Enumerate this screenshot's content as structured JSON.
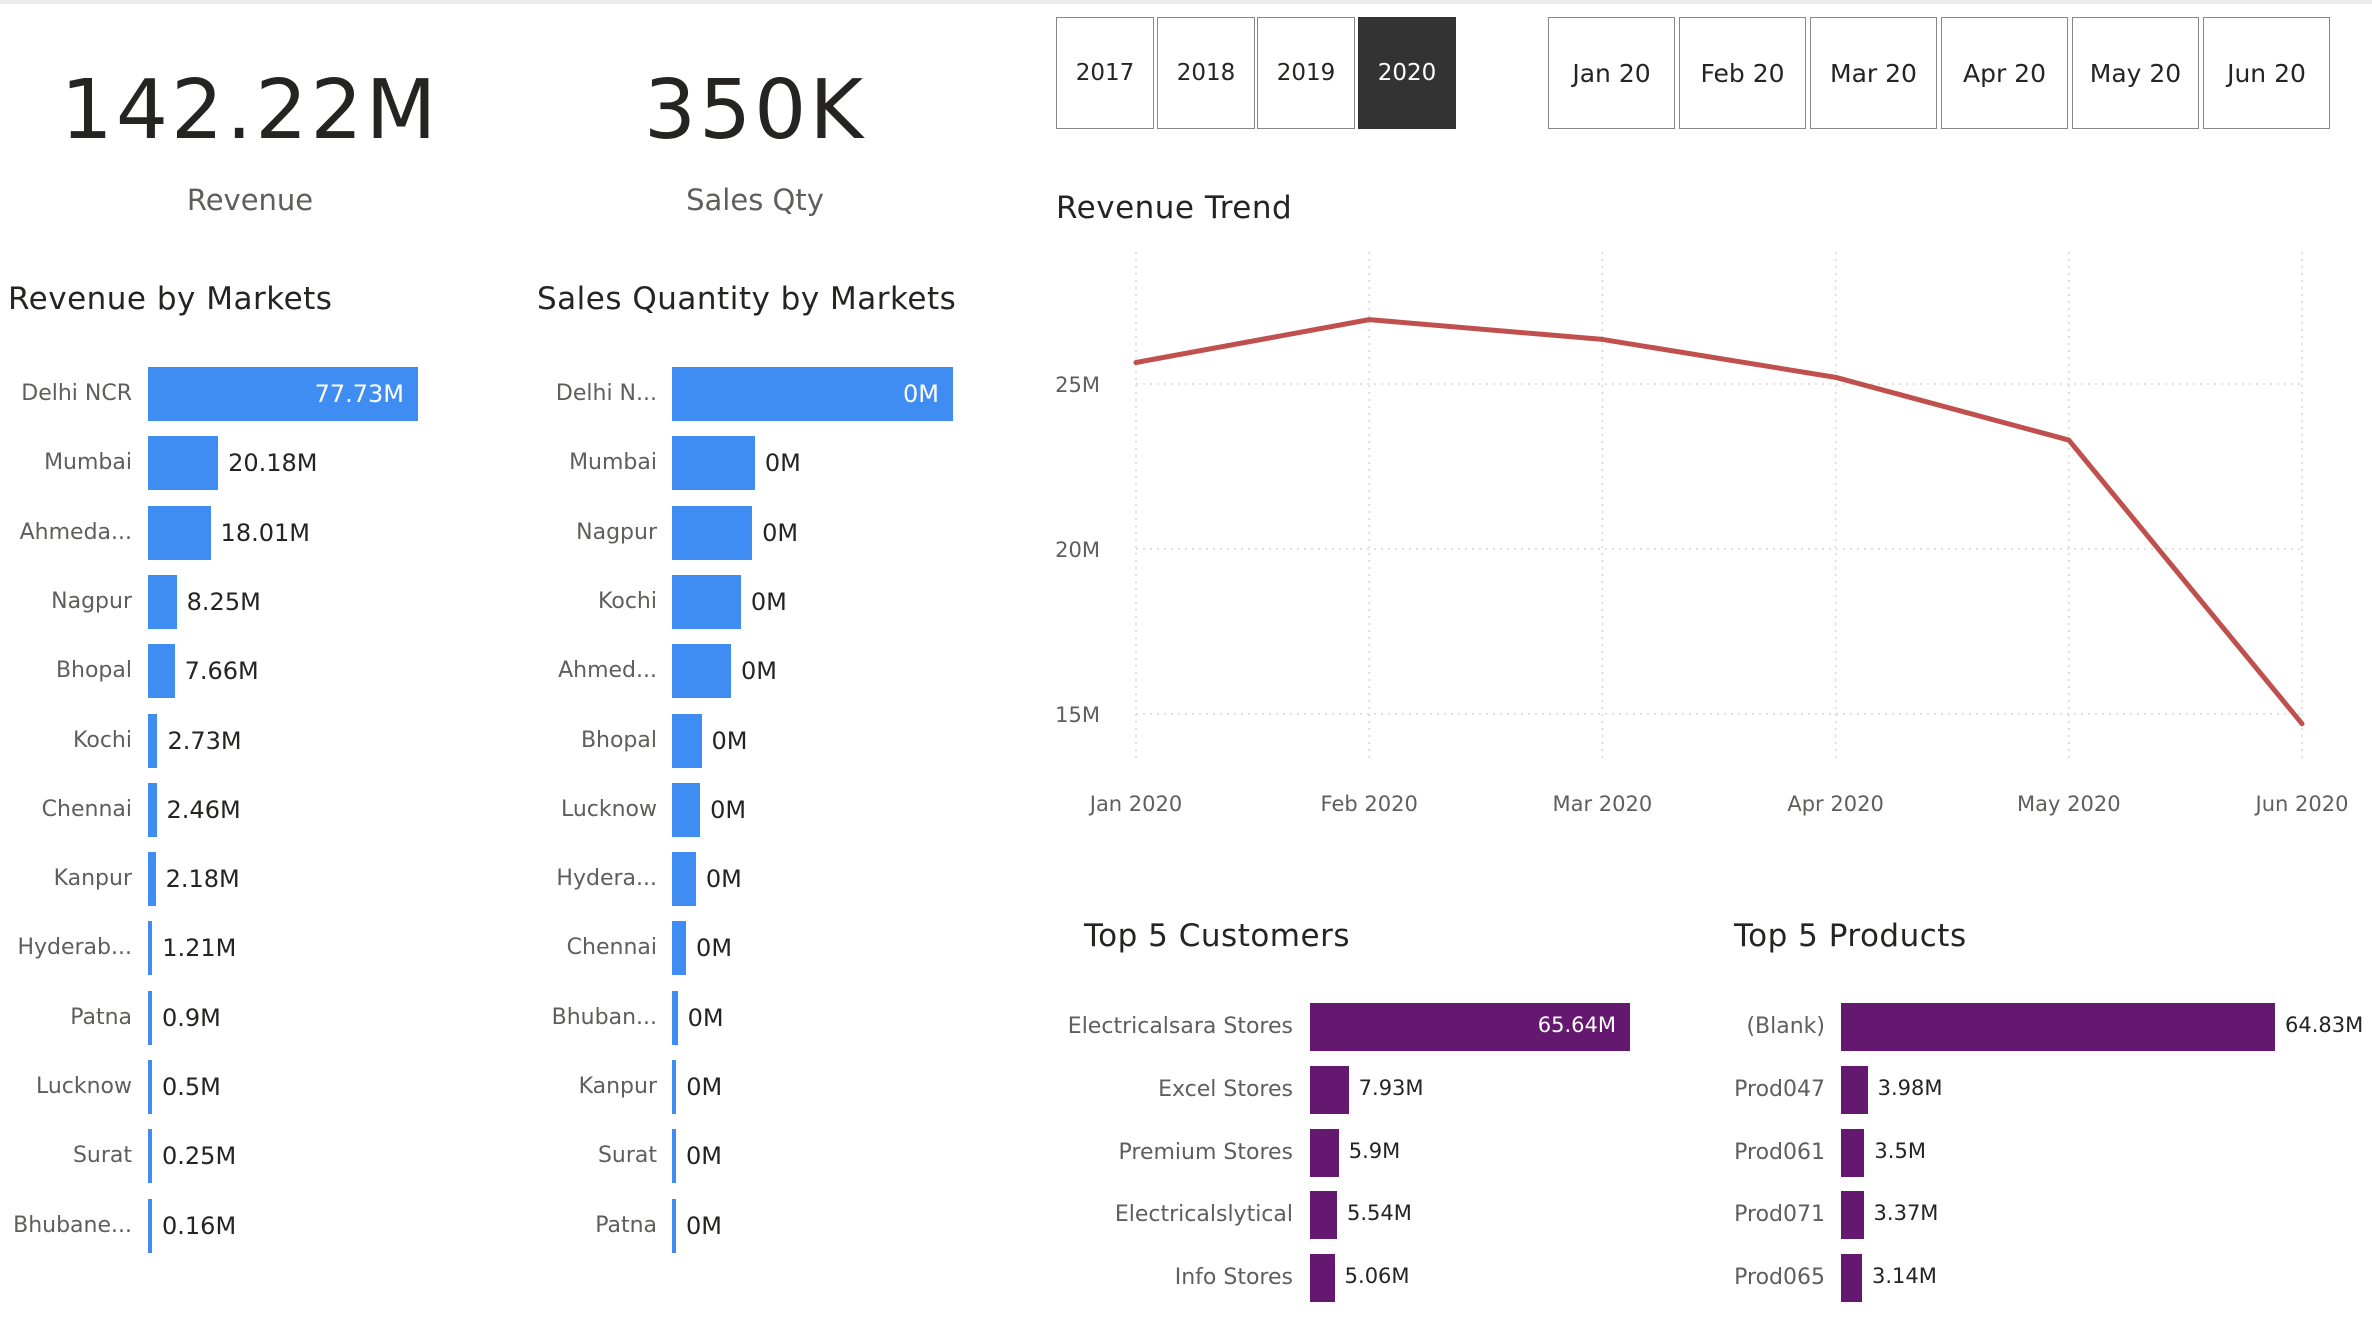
{
  "kpis": {
    "revenue": {
      "value": "142.22M",
      "label": "Revenue"
    },
    "sales_qty": {
      "value": "350K",
      "label": "Sales Qty"
    }
  },
  "year_slicer": {
    "items": [
      "2017",
      "2018",
      "2019",
      "2020"
    ],
    "selected": "2020"
  },
  "month_slicer": {
    "items": [
      "Jan 20",
      "Feb 20",
      "Mar 20",
      "Apr 20",
      "May 20",
      "Jun 20"
    ]
  },
  "colors": {
    "market_bar": "#3f8cf2",
    "top5_bar": "#651870",
    "trend_line": "#c0504d",
    "selected_slicer": "#333333"
  },
  "revenue_by_markets": {
    "title": "Revenue by Markets",
    "chart_data": {
      "type": "bar",
      "orientation": "horizontal",
      "categories": [
        "Delhi NCR",
        "Mumbai",
        "Ahmeda...",
        "Nagpur",
        "Bhopal",
        "Kochi",
        "Chennai",
        "Kanpur",
        "Hyderab...",
        "Patna",
        "Lucknow",
        "Surat",
        "Bhubane..."
      ],
      "values": [
        77.73,
        20.18,
        18.01,
        8.25,
        7.66,
        2.73,
        2.46,
        2.18,
        1.21,
        0.9,
        0.5,
        0.25,
        0.16
      ],
      "labels": [
        "77.73M",
        "20.18M",
        "18.01M",
        "8.25M",
        "7.66M",
        "2.73M",
        "2.46M",
        "2.18M",
        "1.21M",
        "0.9M",
        "0.5M",
        "0.25M",
        "0.16M"
      ],
      "unit": "M"
    }
  },
  "sales_qty_by_markets": {
    "title": "Sales Quantity by Markets",
    "chart_data": {
      "type": "bar",
      "orientation": "horizontal",
      "categories": [
        "Delhi N...",
        "Mumbai",
        "Nagpur",
        "Kochi",
        "Ahmed...",
        "Bhopal",
        "Lucknow",
        "Hydera...",
        "Chennai",
        "Bhuban...",
        "Kanpur",
        "Surat",
        "Patna"
      ],
      "values": [
        1.0,
        0.295,
        0.285,
        0.245,
        0.21,
        0.105,
        0.1,
        0.085,
        0.05,
        0.02,
        0.015,
        0.008,
        0.005
      ],
      "labels": [
        "0M",
        "0M",
        "0M",
        "0M",
        "0M",
        "0M",
        "0M",
        "0M",
        "0M",
        "0M",
        "0M",
        "0M",
        "0M"
      ],
      "value_scale": "relative (labels all print 0M)"
    }
  },
  "revenue_trend": {
    "title": "Revenue Trend",
    "chart_data": {
      "type": "line",
      "x": [
        "Jan 2020",
        "Feb 2020",
        "Mar 2020",
        "Apr 2020",
        "May 2020",
        "Jun 2020"
      ],
      "series": [
        {
          "values": [
            25.65,
            26.95,
            26.35,
            25.2,
            23.3,
            14.7
          ]
        }
      ],
      "yticks": [
        "15M",
        "20M",
        "25M"
      ],
      "ylim": [
        13.6,
        29.0
      ],
      "unit": "M",
      "grid": true
    }
  },
  "top5_customers": {
    "title": "Top 5 Customers",
    "chart_data": {
      "type": "bar",
      "orientation": "horizontal",
      "categories": [
        "Electricalsara Stores",
        "Excel Stores",
        "Premium Stores",
        "Electricalslytical",
        "Info Stores"
      ],
      "values": [
        65.64,
        7.93,
        5.9,
        5.54,
        5.06
      ],
      "labels": [
        "65.64M",
        "7.93M",
        "5.9M",
        "5.54M",
        "5.06M"
      ],
      "unit": "M"
    }
  },
  "top5_products": {
    "title": "Top 5 Products",
    "chart_data": {
      "type": "bar",
      "orientation": "horizontal",
      "categories": [
        "(Blank)",
        "Prod047",
        "Prod061",
        "Prod071",
        "Prod065"
      ],
      "values": [
        64.83,
        3.98,
        3.5,
        3.37,
        3.14
      ],
      "labels": [
        "64.83M",
        "3.98M",
        "3.5M",
        "3.37M",
        "3.14M"
      ],
      "unit": "M"
    }
  }
}
